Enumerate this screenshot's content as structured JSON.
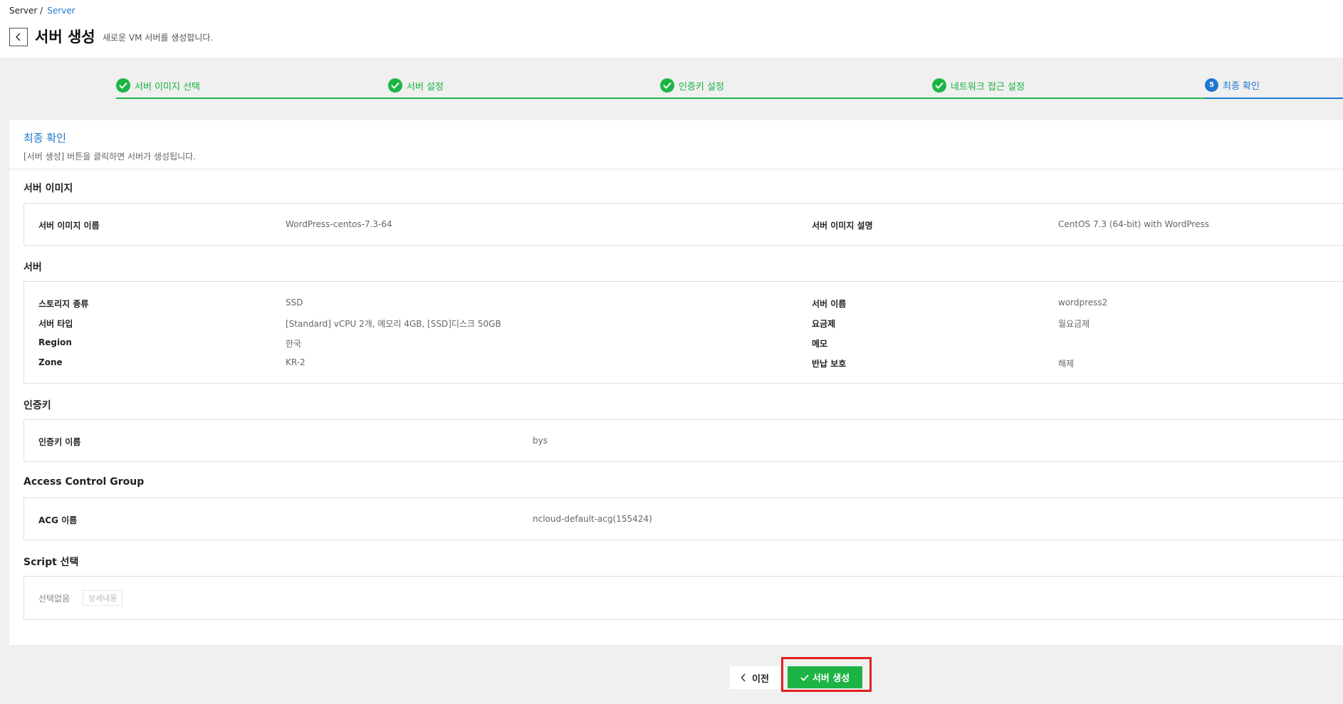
{
  "breadcrumb": {
    "root": "Server /",
    "current": "Server"
  },
  "header": {
    "title": "서버 생성",
    "subtitle": "새로운 VM 서버를 생성합니다."
  },
  "steps": [
    {
      "label": "서버 이미지 선택",
      "state": "done"
    },
    {
      "label": "서버 설정",
      "state": "done"
    },
    {
      "label": "인증키 설정",
      "state": "done"
    },
    {
      "label": "네트워크 접근 설정",
      "state": "done"
    },
    {
      "label": "최종 확인",
      "state": "active",
      "number": "5"
    }
  ],
  "panel": {
    "title": "최종 확인",
    "description": "[서버 생성] 버튼을 클릭하면 서버가 생성됩니다."
  },
  "server_image": {
    "title": "서버 이미지",
    "name_label": "서버 이미지 이름",
    "name_value": "WordPress-centos-7.3-64",
    "desc_label": "서버 이미지 설명",
    "desc_value": "CentOS 7.3 (64-bit) with WordPress"
  },
  "server": {
    "title": "서버",
    "left": [
      {
        "label": "스토리지 종류",
        "value": "SSD"
      },
      {
        "label": "서버 타입",
        "value": "[Standard] vCPU 2개, 메모리 4GB, [SSD]디스크 50GB"
      },
      {
        "label": "Region",
        "value": "한국"
      },
      {
        "label": "Zone",
        "value": "KR-2"
      }
    ],
    "right": [
      {
        "label": "서버 이름",
        "value": "wordpress2"
      },
      {
        "label": "요금제",
        "value": "월요금제"
      },
      {
        "label": "메모",
        "value": ""
      },
      {
        "label": "반납 보호",
        "value": "해제"
      }
    ]
  },
  "auth_key": {
    "title": "인증키",
    "label": "인증키 이름",
    "value": "bys"
  },
  "acg": {
    "title": "Access Control Group",
    "label": "ACG 이름",
    "value": "ncloud-default-acg(155424)"
  },
  "script": {
    "title": "Script 선택",
    "value": "선택없음",
    "detail_button": "상세내용"
  },
  "buttons": {
    "prev": "이전",
    "create": "서버 생성"
  },
  "colors": {
    "accent_green": "#1db446",
    "accent_blue": "#1f77d0",
    "highlight_red": "#e02020"
  }
}
